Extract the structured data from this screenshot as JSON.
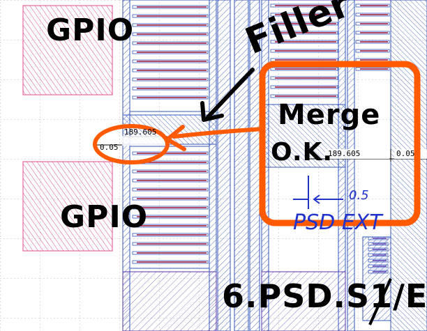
{
  "labels": {
    "gpio_top": "GPIO",
    "gpio_bottom": "GPIO",
    "filler": "Filler",
    "merge": "Merge",
    "ok": "O.K.",
    "psd_ext": "PSD EXT",
    "rule": "6.PSD.S1/E"
  },
  "dimensions": {
    "left_value": "189.605",
    "left_spacing": "0.05",
    "right_value": "189.605",
    "right_spacing": "0.05",
    "gap": "0.5"
  },
  "colors": {
    "pink_hatch": "#e64a8c",
    "blue_hatch": "#3355bb",
    "purple_outline": "#5533aa",
    "red_finger": "#a01030",
    "orange_markup": "#ff5a00",
    "blue_ink": "#2233cc",
    "grid": "#bbbbbb"
  }
}
